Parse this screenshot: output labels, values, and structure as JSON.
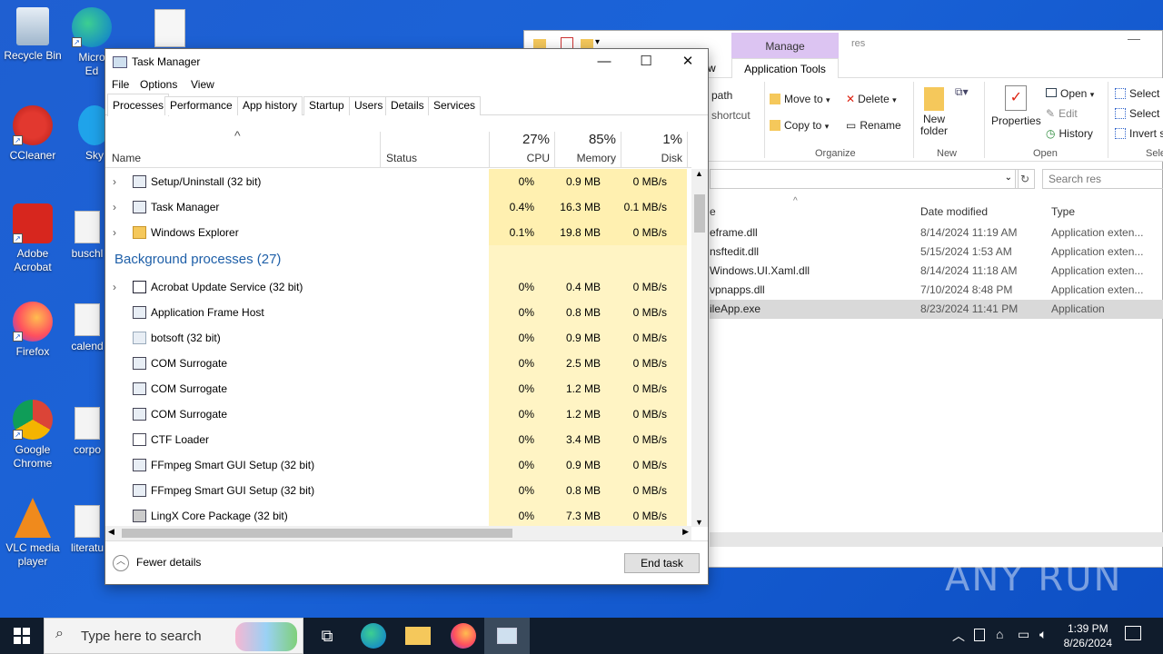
{
  "desktop": {
    "icons": [
      {
        "label": "Recycle Bin"
      },
      {
        "label": "Micro\nEd"
      },
      {
        "label": "CCleaner"
      },
      {
        "label": "Sky"
      },
      {
        "label": "Adobe\nAcrobat"
      },
      {
        "label": "buschl"
      },
      {
        "label": "Firefox"
      },
      {
        "label": "calend"
      },
      {
        "label": "Google\nChrome"
      },
      {
        "label": "corpo"
      },
      {
        "label": "VLC media\nplayer"
      },
      {
        "label": "literatu"
      }
    ]
  },
  "explorer": {
    "title": "res",
    "manage_tab": "Manage",
    "app_tools_tab": "Application Tools",
    "partial_tab": "w",
    "ribbon": {
      "path": "path",
      "shortcut": "shortcut",
      "move_to": "Move to",
      "copy_to": "Copy to",
      "delete": "Delete",
      "rename": "Rename",
      "organize": "Organize",
      "new_folder": "New\nfolder",
      "new": "New",
      "properties": "Properties",
      "open": "Open",
      "edit": "Edit",
      "history": "History",
      "open_group": "Open",
      "select_all": "Select a",
      "select_none": "Select n",
      "invert": "Invert s",
      "select_group": "Sele"
    },
    "search_placeholder": "Search res",
    "columns": {
      "name": "e",
      "date": "Date modified",
      "type": "Type"
    },
    "files": [
      {
        "name": "eframe.dll",
        "date": "8/14/2024 11:19 AM",
        "type": "Application exten..."
      },
      {
        "name": "nsftedit.dll",
        "date": "5/15/2024 1:53 AM",
        "type": "Application exten..."
      },
      {
        "name": "Windows.UI.Xaml.dll",
        "date": "8/14/2024 11:18 AM",
        "type": "Application exten..."
      },
      {
        "name": "vpnapps.dll",
        "date": "7/10/2024 8:48 PM",
        "type": "Application exten..."
      },
      {
        "name": "ileApp.exe",
        "date": "8/23/2024 11:41 PM",
        "type": "Application"
      }
    ]
  },
  "taskmanager": {
    "title": "Task Manager",
    "menu": [
      "File",
      "Options",
      "View"
    ],
    "tabs": [
      "Processes",
      "Performance",
      "App history",
      "Startup",
      "Users",
      "Details",
      "Services"
    ],
    "columns": {
      "name": "Name",
      "status": "Status",
      "cpu_pct": "27%",
      "cpu": "CPU",
      "mem_pct": "85%",
      "mem": "Memory",
      "disk_pct": "1%",
      "disk": "Disk"
    },
    "apps": [
      {
        "name": "Setup/Uninstall (32 bit)",
        "cpu": "0%",
        "mem": "0.9 MB",
        "disk": "0 MB/s"
      },
      {
        "name": "Task Manager",
        "cpu": "0.4%",
        "mem": "16.3 MB",
        "disk": "0.1 MB/s"
      },
      {
        "name": "Windows Explorer",
        "cpu": "0.1%",
        "mem": "19.8 MB",
        "disk": "0 MB/s"
      }
    ],
    "background_header": "Background processes (27)",
    "background": [
      {
        "name": "Acrobat Update Service (32 bit)",
        "cpu": "0%",
        "mem": "0.4 MB",
        "disk": "0 MB/s"
      },
      {
        "name": "Application Frame Host",
        "cpu": "0%",
        "mem": "0.8 MB",
        "disk": "0 MB/s"
      },
      {
        "name": "botsoft (32 bit)",
        "cpu": "0%",
        "mem": "0.9 MB",
        "disk": "0 MB/s"
      },
      {
        "name": "COM Surrogate",
        "cpu": "0%",
        "mem": "2.5 MB",
        "disk": "0 MB/s"
      },
      {
        "name": "COM Surrogate",
        "cpu": "0%",
        "mem": "1.2 MB",
        "disk": "0 MB/s"
      },
      {
        "name": "COM Surrogate",
        "cpu": "0%",
        "mem": "1.2 MB",
        "disk": "0 MB/s"
      },
      {
        "name": "CTF Loader",
        "cpu": "0%",
        "mem": "3.4 MB",
        "disk": "0 MB/s"
      },
      {
        "name": "FFmpeg Smart GUI Setup (32 bit)",
        "cpu": "0%",
        "mem": "0.9 MB",
        "disk": "0 MB/s"
      },
      {
        "name": "FFmpeg Smart GUI Setup (32 bit)",
        "cpu": "0%",
        "mem": "0.8 MB",
        "disk": "0 MB/s"
      },
      {
        "name": "LingX Core Package (32 bit)",
        "cpu": "0%",
        "mem": "7.3 MB",
        "disk": "0 MB/s"
      }
    ],
    "fewer_details": "Fewer details",
    "end_task": "End task"
  },
  "taskbar": {
    "search_placeholder": "Type here to search",
    "time": "1:39 PM",
    "date": "8/26/2024"
  },
  "watermark": "ANY RUN"
}
